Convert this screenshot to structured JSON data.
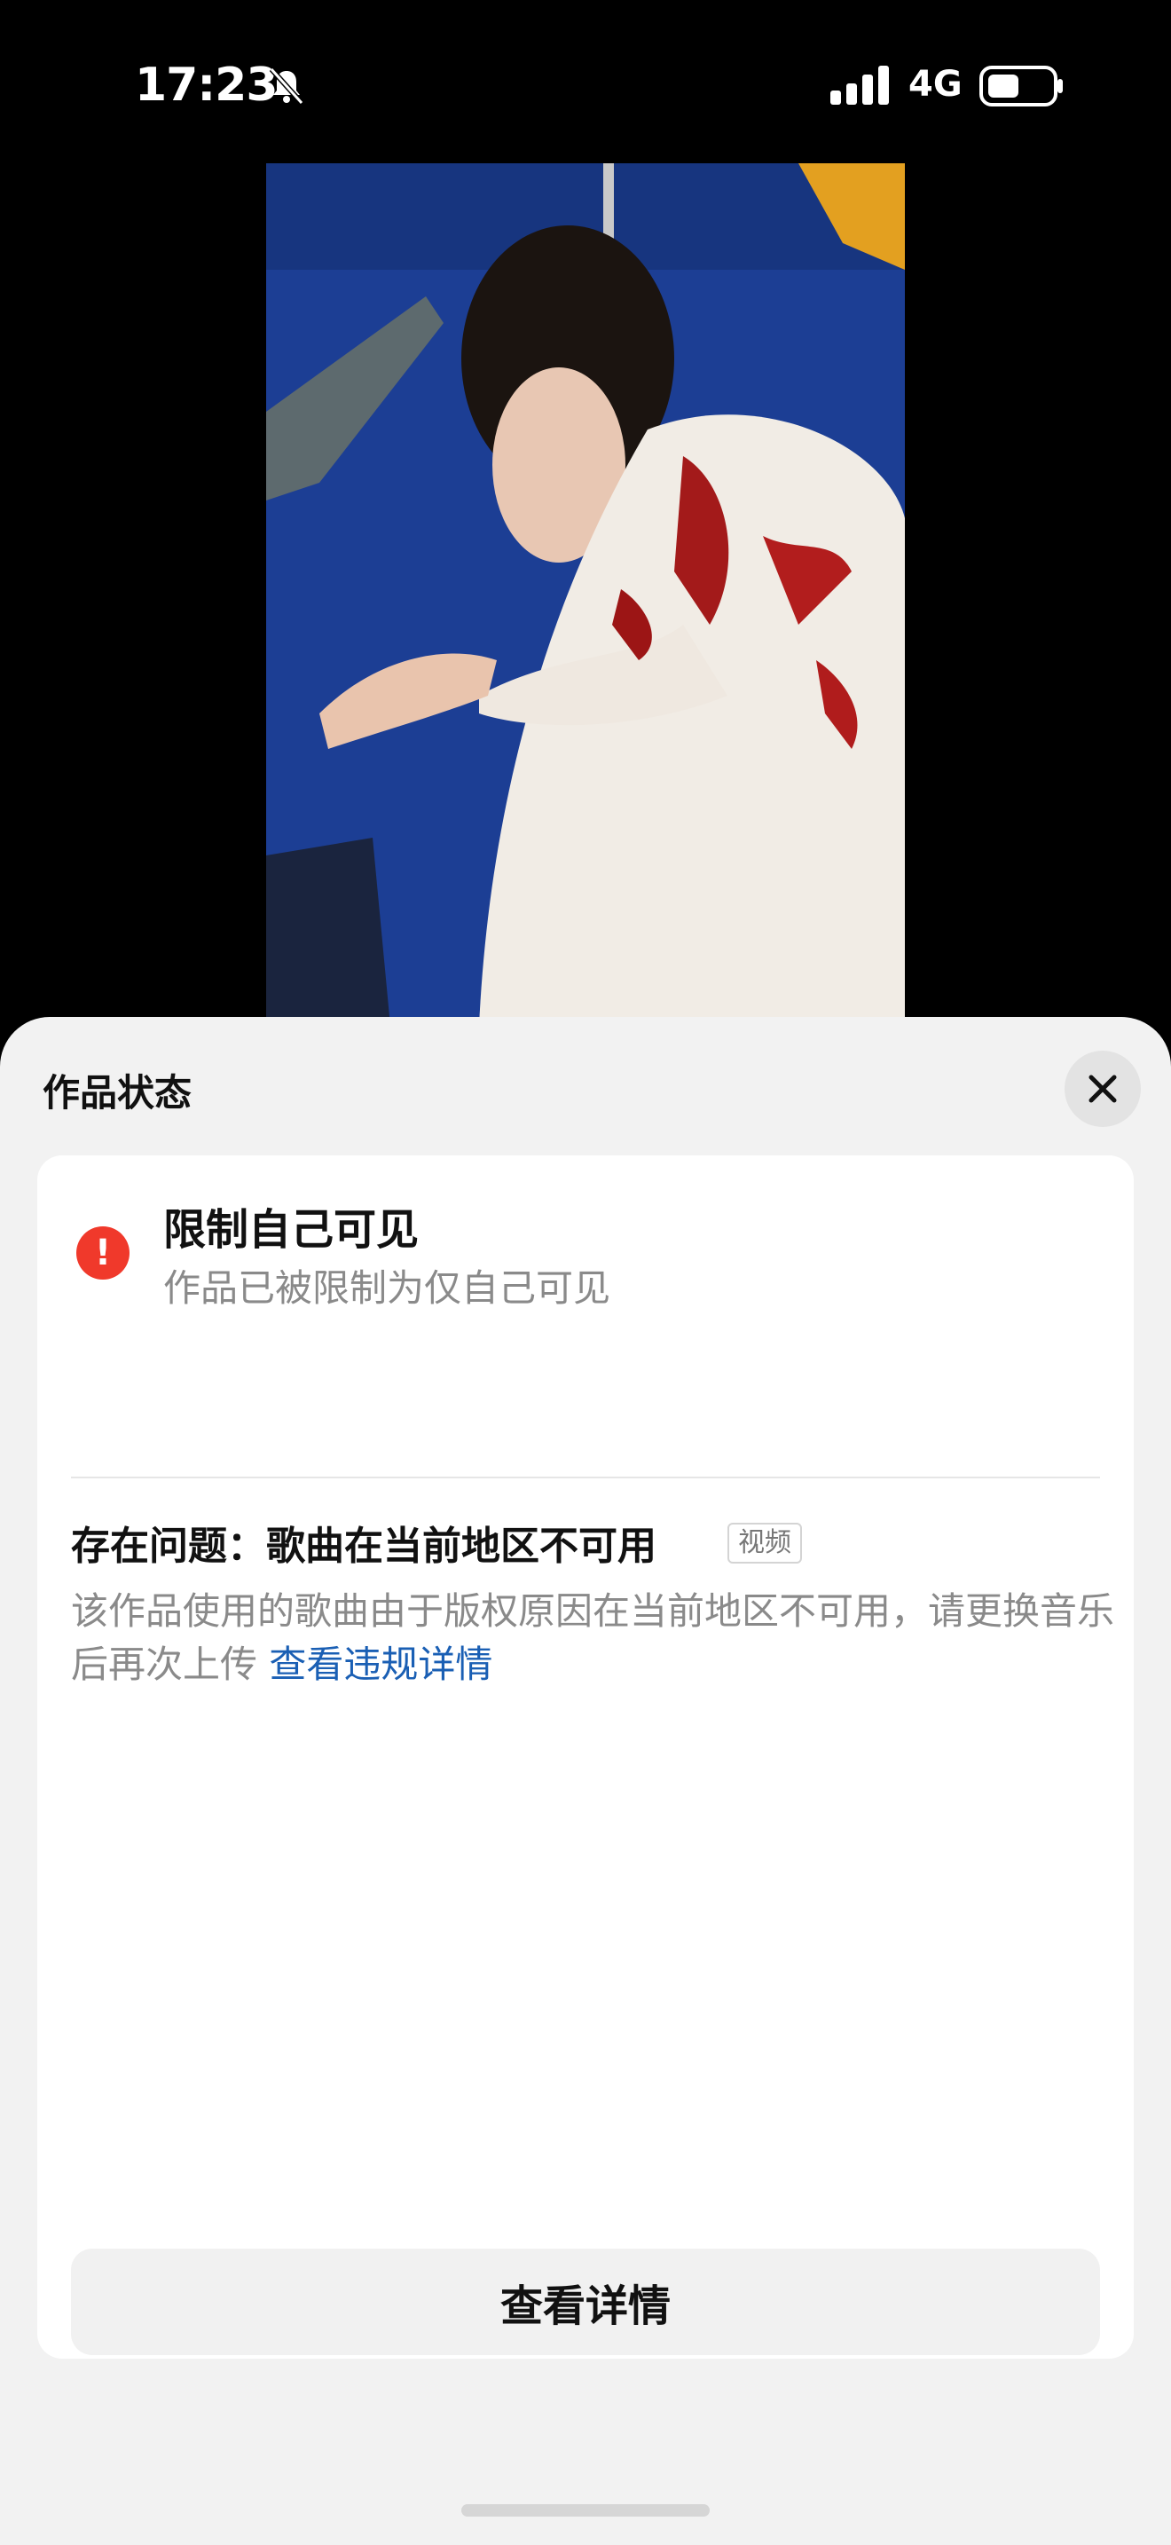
{
  "status_bar": {
    "time": "17:23",
    "network": "4G",
    "bell_icon": "bell-muted-icon",
    "signal_icon": "cellular-signal-icon",
    "battery_icon": "battery-icon"
  },
  "sheet": {
    "title": "作品状态",
    "close_icon": "close-icon",
    "status_title": "限制自己可见",
    "status_subtitle": "作品已被限制为仅自己可见",
    "alert_icon": "exclamation-alert-icon",
    "alert_symbol": "!",
    "issue_title": "存在问题：歌曲在当前地区不可用",
    "issue_tag": "视频",
    "issue_desc": "该作品使用的歌曲由于版权原因在当前地区不可用，请更换音乐后再次上传",
    "issue_link": "查看违规详情",
    "detail_button": "查看详情"
  },
  "colors": {
    "alert": "#f0392b",
    "link": "#1a5fb4",
    "sheet_bg": "#f2f2f2"
  }
}
